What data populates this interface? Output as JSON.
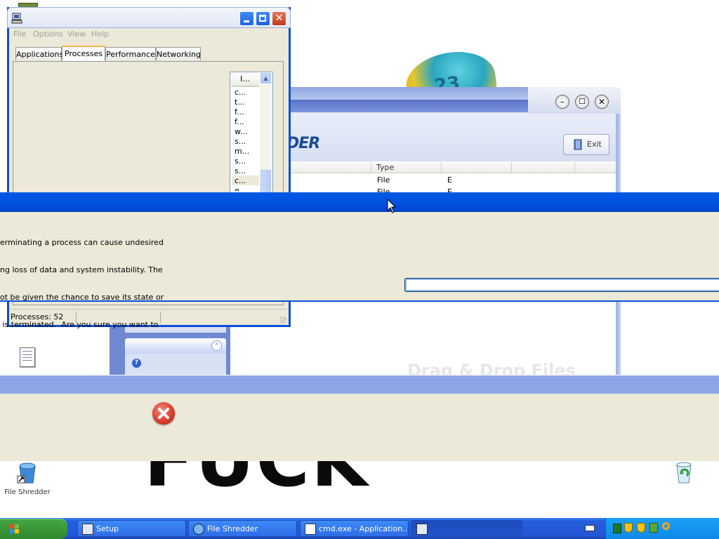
{
  "desktop": {
    "shredder_icon_label": "File Shredder",
    "drag_hint": "Drag & Drop Files Here",
    "wallpaper_text": "FUCK YOU"
  },
  "task_manager": {
    "menu": [
      "File",
      "Options",
      "View",
      "Help"
    ],
    "tabs": [
      "Applications",
      "Processes",
      "Performance",
      "Networking"
    ],
    "selected_tab": "Processes",
    "column_header": "I...",
    "processes": [
      "c...",
      "t...",
      "f...",
      "f...",
      "w...",
      "s...",
      "m...",
      "s...",
      "s...",
      "c...",
      "e..."
    ],
    "status": "Processes: 52"
  },
  "file_shredder": {
    "brand": "DER",
    "exit_label": "Exit",
    "columns": [
      "Type"
    ],
    "rows": [
      {
        "type": "File",
        "col3": "E"
      },
      {
        "type": "File",
        "col3": "E"
      }
    ]
  },
  "dialog_warning": {
    "message_lines": [
      "erminating a process can cause undesired",
      "ng loss of data and system instability. The",
      "ot be given the chance to save its state or",
      " is terminated.  Are you sure you want to"
    ]
  },
  "taskbar": {
    "start": "start",
    "buttons": [
      "Setup",
      "File Shredder",
      "cmd.exe - Application...",
      ""
    ]
  },
  "colors": {
    "xp_blue": "#0053de",
    "dialog_bg": "#ece9d8",
    "error_red": "#d63b2b"
  }
}
